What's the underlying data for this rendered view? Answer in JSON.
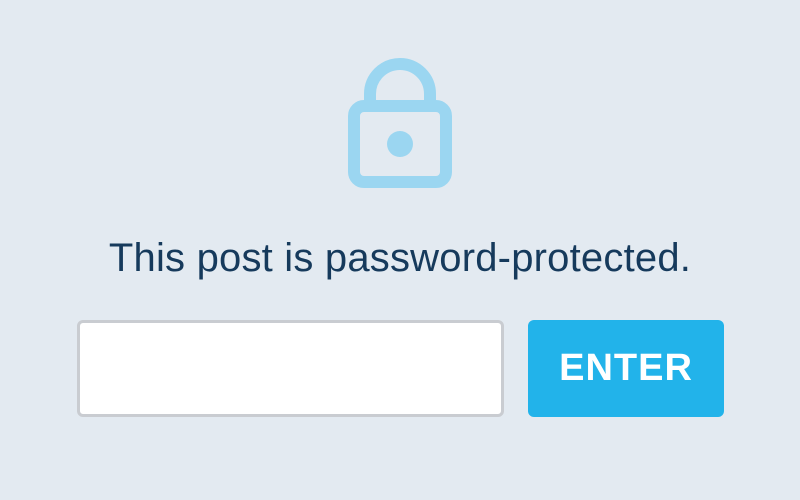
{
  "colors": {
    "background": "#e3eaf1",
    "lock": "#9bd6f1",
    "message_text": "#163a5c",
    "button_bg": "#22b3ea",
    "button_text": "#ffffff",
    "input_border": "#c9ccd1"
  },
  "lock": {
    "icon": "lock-icon"
  },
  "message": "This post is password-protected.",
  "form": {
    "password_value": "",
    "password_placeholder": "",
    "enter_label": "ENTER"
  }
}
